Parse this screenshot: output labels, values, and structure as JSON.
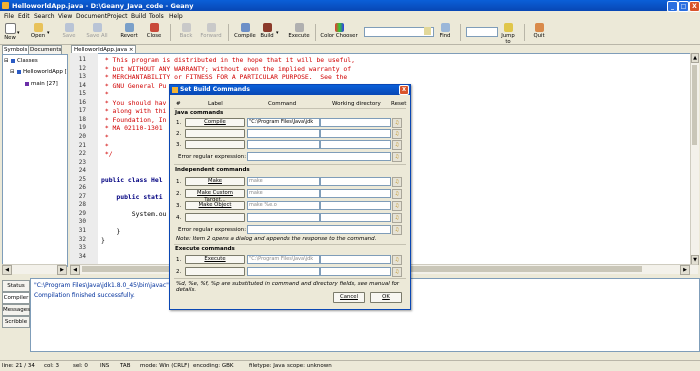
{
  "window": {
    "title": "HelloworldApp.java - D:\\Geany_Java_code - Geany",
    "min": "_",
    "max": "□",
    "close": "X"
  },
  "menu": [
    "File",
    "Edit",
    "Search",
    "View",
    "Document",
    "Project",
    "Build",
    "Tools",
    "Help"
  ],
  "toolbar": {
    "new": "New",
    "open": "Open",
    "save": "Save",
    "save_all": "Save All",
    "revert": "Revert",
    "close": "Close",
    "back": "Back",
    "forward": "Forward",
    "compile": "Compile",
    "build": "Build",
    "execute": "Execute",
    "color_chooser": "Color Chooser",
    "find": "Find",
    "jump_to": "Jump to",
    "quit": "Quit",
    "dropdown_arrow": "▾"
  },
  "sidebar": {
    "tabs": [
      "Symbols",
      "Documents"
    ],
    "tree": {
      "root": "Classes",
      "class": "HelloworldApp [",
      "method": "main [27]"
    },
    "expand": "⊟"
  },
  "editor": {
    "tab": "HelloworldApp.java",
    "tab_close": "×",
    "lines": [
      {
        "n": "11",
        "t": " * This program is distributed in the hope that it will be useful,",
        "c": "cmt"
      },
      {
        "n": "12",
        "t": " * but WITHOUT ANY WARRANTY; without even the implied warranty of",
        "c": "cmt"
      },
      {
        "n": "13",
        "t": " * MERCHANTABILITY or FITNESS FOR A PARTICULAR PURPOSE.  See the",
        "c": "cmt"
      },
      {
        "n": "14",
        "t": " * GNU General Pu",
        "c": "cmt"
      },
      {
        "n": "15",
        "t": " *",
        "c": "cmt"
      },
      {
        "n": "16",
        "t": " * You should hav",
        "c": "cmt"
      },
      {
        "n": "17",
        "t": " * along with thi",
        "c": "cmt"
      },
      {
        "n": "18",
        "t": " * Foundation, In",
        "c": "cmt"
      },
      {
        "n": "19",
        "t": " * MA 02110-1301",
        "c": "cmt"
      },
      {
        "n": "20",
        "t": " *",
        "c": "cmt"
      },
      {
        "n": "21",
        "t": " *",
        "c": "cmt"
      },
      {
        "n": "22",
        "t": " */",
        "c": "cmt"
      },
      {
        "n": "23",
        "t": "",
        "c": ""
      },
      {
        "n": "24",
        "t": "",
        "c": ""
      },
      {
        "n": "25",
        "t": "public class Hel",
        "c": "kw"
      },
      {
        "n": "26",
        "t": "",
        "c": ""
      },
      {
        "n": "27",
        "t": "    public stati",
        "c": "kw"
      },
      {
        "n": "28",
        "t": "",
        "c": ""
      },
      {
        "n": "29",
        "t": "        System.ou",
        "c": ""
      },
      {
        "n": "30",
        "t": "",
        "c": ""
      },
      {
        "n": "31",
        "t": "    }",
        "c": ""
      },
      {
        "n": "32",
        "t": "}",
        "c": ""
      },
      {
        "n": "33",
        "t": "",
        "c": ""
      },
      {
        "n": "34",
        "t": "",
        "c": ""
      }
    ]
  },
  "messages": {
    "tabs": [
      "Status",
      "Compiler",
      "Messages",
      "Scribble"
    ],
    "lines": [
      "\"C:\\Program Files\\Java\\jdk1.8.0_45\\bin\\javac\"",
      "Compilation finished successfully."
    ]
  },
  "status": {
    "line": "line: 21 / 34",
    "col": "col: 3",
    "sel": "sel: 0",
    "ins": "INS",
    "tab": "TAB",
    "mode": "mode: Win (CRLF)",
    "encoding": "encoding: GBK",
    "filetype": "filetype: Java",
    "scope": "scope: unknown"
  },
  "dialog": {
    "title": "Set Build Commands",
    "close": "X",
    "headers": {
      "num": "#",
      "label": "Label",
      "command": "Command",
      "workdir": "Working directory",
      "reset": "Reset"
    },
    "java_section": "Java commands",
    "java_rows": [
      {
        "n": "1.",
        "label": "Compile",
        "command": "\"C:\\Program Files\\Java\\jdk",
        "workdir": ""
      },
      {
        "n": "2.",
        "label": "",
        "command": "",
        "workdir": ""
      },
      {
        "n": "3.",
        "label": "",
        "command": "",
        "workdir": ""
      }
    ],
    "error_regex": "Error regular expression:",
    "indep_section": "Independent commands",
    "indep_rows": [
      {
        "n": "1.",
        "label": "Make",
        "command": "make",
        "workdir": ""
      },
      {
        "n": "2.",
        "label": "Make Custom Target...",
        "command": "make",
        "workdir": ""
      },
      {
        "n": "3.",
        "label": "Make Object",
        "command": "make %e.o",
        "workdir": ""
      },
      {
        "n": "4.",
        "label": "",
        "command": "",
        "workdir": ""
      }
    ],
    "error_regex2": "Error regular expression:",
    "note": "Note: Item 2 opens a dialog and appends the response to the command.",
    "exec_section": "Execute commands",
    "exec_rows": [
      {
        "n": "1.",
        "label": "Execute",
        "command": "\"C:\\Program Files\\Java\\jdk",
        "workdir": ""
      },
      {
        "n": "2.",
        "label": "",
        "command": "",
        "workdir": ""
      }
    ],
    "footer": "%d, %e, %f, %p are substituted in command and directory fields, see manual for details.",
    "cancel": "Cancel",
    "ok": "OK",
    "reset_icon": "♫"
  }
}
